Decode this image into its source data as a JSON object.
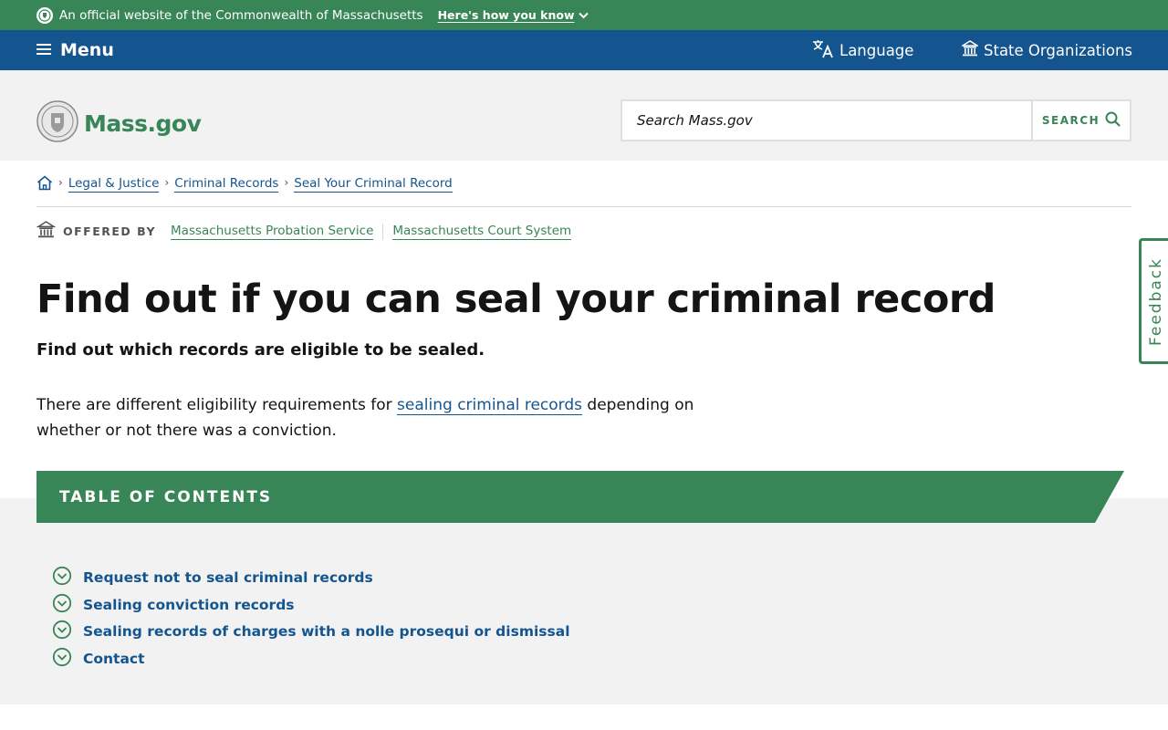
{
  "official_bar": {
    "text": "An official website of the Commonwealth of Massachusetts",
    "how_link": "Here's how you know"
  },
  "nav": {
    "menu_label": "Menu",
    "language_label": "Language",
    "state_orgs_label": "State Organizations"
  },
  "header": {
    "logo_text": "Mass.gov",
    "search_placeholder": "Search Mass.gov",
    "search_button": "SEARCH"
  },
  "breadcrumb": {
    "items": [
      "Legal & Justice",
      "Criminal Records",
      "Seal Your Criminal Record"
    ]
  },
  "offered_by": {
    "label": "OFFERED BY",
    "orgs": [
      "Massachusetts Probation Service",
      "Massachusetts Court System"
    ]
  },
  "page": {
    "title": "Find out if you can seal your criminal record",
    "subtitle": "Find out which records are eligible to be sealed.",
    "intro_before": "There are different eligibility requirements for ",
    "intro_link": "sealing criminal records",
    "intro_after": " depending on whether or not there was a conviction."
  },
  "toc": {
    "title": "TABLE OF CONTENTS",
    "items": [
      "Request not to seal criminal records",
      "Sealing conviction records",
      "Sealing records of charges with a nolle prosequi or dismissal",
      "Contact"
    ]
  },
  "feedback": {
    "label": "Feedback"
  },
  "colors": {
    "green": "#388557",
    "blue": "#14558f",
    "gray_bg": "#f2f2f2"
  }
}
